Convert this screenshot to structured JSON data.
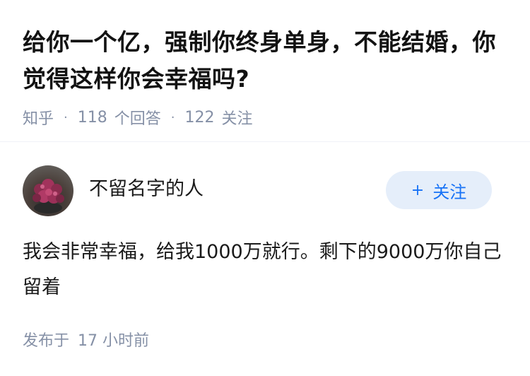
{
  "question": {
    "title": "给你一个亿，强制你终身单身，不能结婚，你觉得这样你会幸福吗?",
    "source": "知乎",
    "answer_count": "118",
    "answer_label": "个回答",
    "follower_count": "122",
    "follower_label": "关注"
  },
  "answer": {
    "author_name": "不留名字的人",
    "follow_button": "关注",
    "content": "我会非常幸福，给我1000万就行。剩下的9000万你自己留着",
    "published_label": "发布于",
    "published_time": "17 小时前"
  },
  "colors": {
    "meta_gray": "#8590a6",
    "accent_blue": "#1772f6",
    "follow_bg": "#e5eefa"
  },
  "icons": {
    "plus": "plus-icon",
    "dot": "dot-separator"
  }
}
